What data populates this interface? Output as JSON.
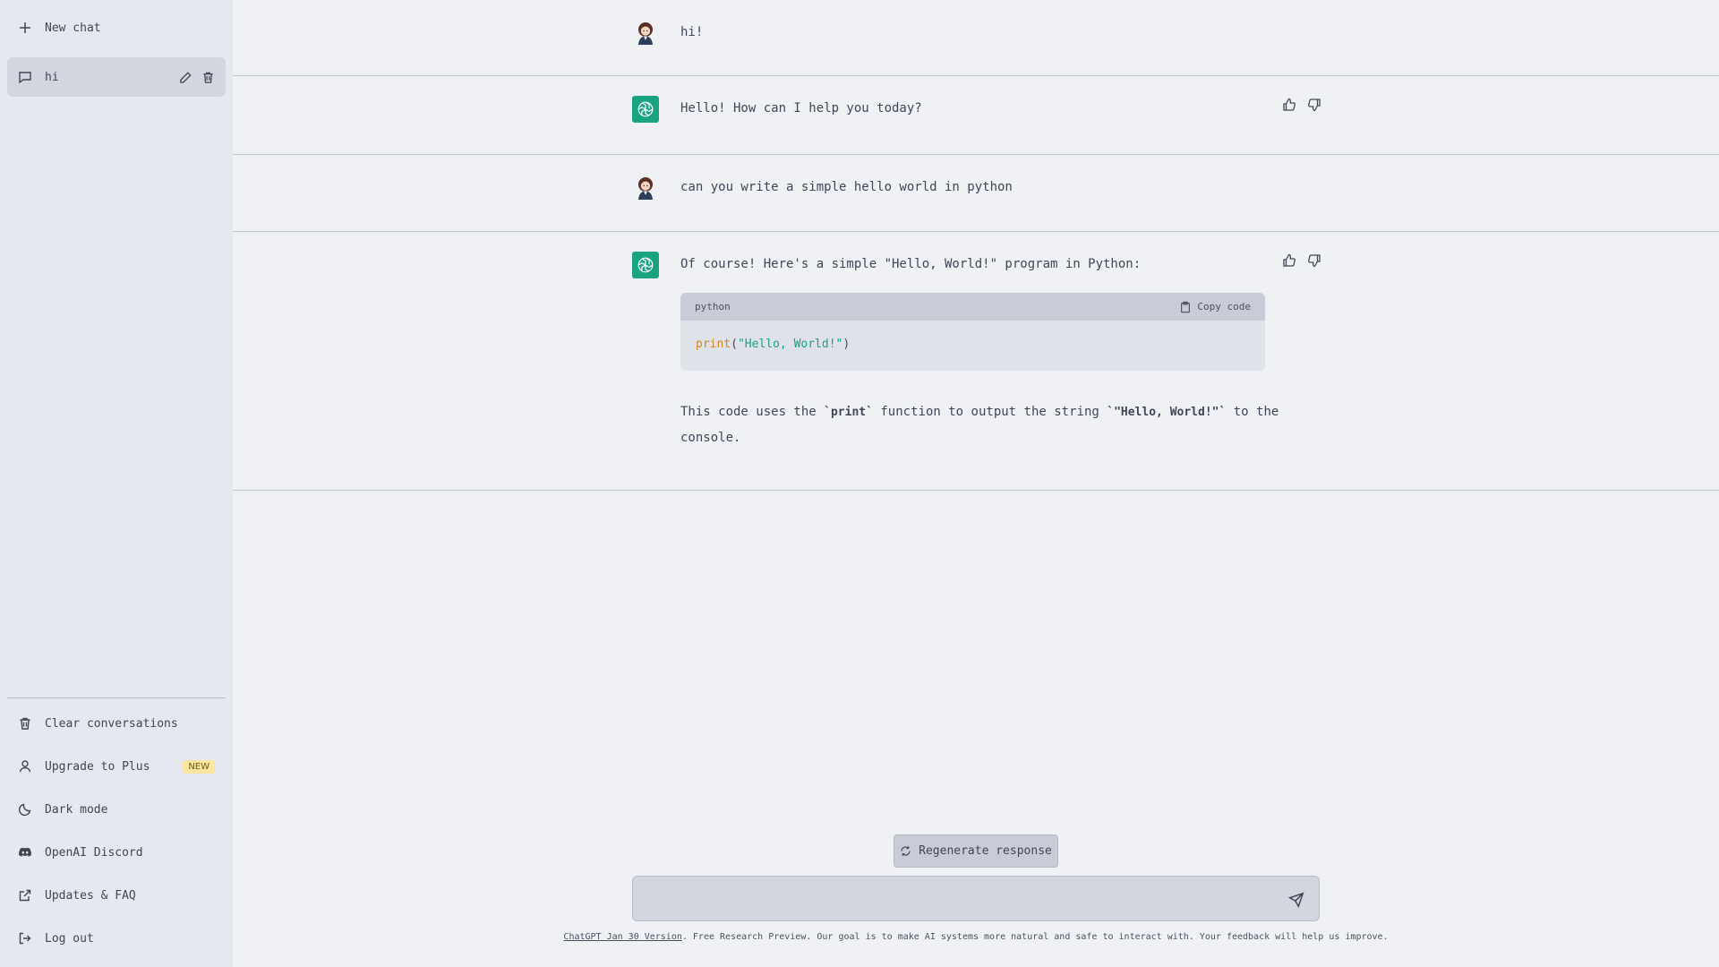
{
  "sidebar": {
    "new_chat": "New chat",
    "conversations": [
      {
        "title": "hi"
      }
    ],
    "bottom": {
      "clear": "Clear conversations",
      "upgrade": "Upgrade to Plus",
      "upgrade_badge": "NEW",
      "dark_mode": "Dark mode",
      "discord": "OpenAI Discord",
      "updates": "Updates & FAQ",
      "logout": "Log out"
    }
  },
  "messages": [
    {
      "role": "user",
      "text": "hi!"
    },
    {
      "role": "assistant",
      "text": "Hello! How can I help you today?"
    },
    {
      "role": "user",
      "text": "can you write a simple hello world in python"
    },
    {
      "role": "assistant",
      "intro": "Of course! Here's a simple \"Hello, World!\" program in Python:",
      "code": {
        "language": "python",
        "copy_label": "Copy code",
        "tokens": {
          "fn": "print",
          "open": "(",
          "str": "\"Hello, World!\"",
          "close": ")"
        }
      },
      "outro": {
        "part1": "This code uses the ",
        "code1": "`print`",
        "part2": " function to output the string ",
        "code2": "`\"Hello, World!\"`",
        "part3": " to the console."
      }
    }
  ],
  "composer": {
    "regenerate": "Regenerate response",
    "placeholder": ""
  },
  "footer": {
    "version_link": "ChatGPT Jan 30 Version",
    "text": ". Free Research Preview. Our goal is to make AI systems more natural and safe to interact with. Your feedback will help us improve."
  },
  "colors": {
    "accent": "#19a37f",
    "badge": "#fae69e",
    "sidebar_bg": "#e5e8ee",
    "main_bg": "#eff1f5"
  }
}
